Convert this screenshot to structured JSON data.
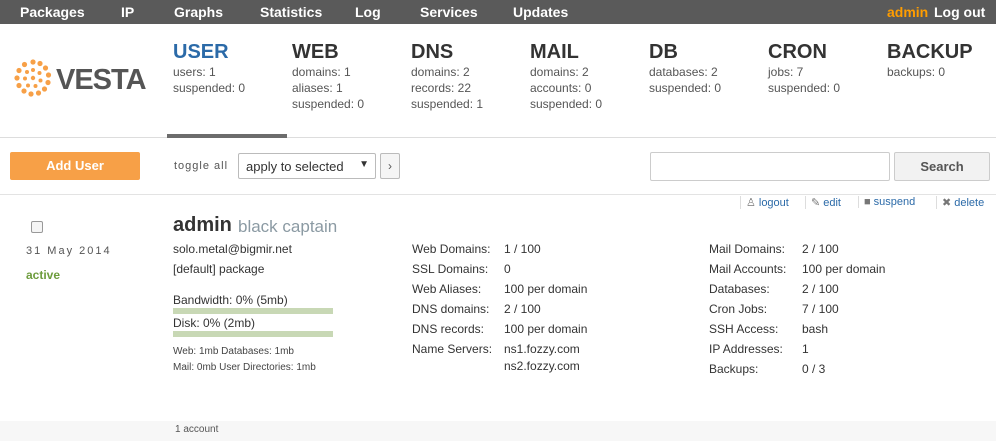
{
  "topnav": {
    "items": [
      "Packages",
      "IP",
      "Graphs",
      "Statistics",
      "Log",
      "Services",
      "Updates"
    ],
    "user": "admin",
    "logout": "Log out"
  },
  "logo": {
    "text": "VESTA",
    "color": "#f7a047"
  },
  "stats": [
    {
      "title": "USER",
      "lines": [
        "users: 1",
        "suspended: 0"
      ]
    },
    {
      "title": "WEB",
      "lines": [
        "domains: 1",
        "aliases: 1",
        "suspended: 0"
      ]
    },
    {
      "title": "DNS",
      "lines": [
        "domains: 2",
        "records: 22",
        "suspended: 1"
      ]
    },
    {
      "title": "MAIL",
      "lines": [
        "domains: 2",
        "accounts: 0",
        "suspended: 0"
      ]
    },
    {
      "title": "DB",
      "lines": [
        "databases: 2",
        "suspended: 0"
      ]
    },
    {
      "title": "CRON",
      "lines": [
        "jobs: 7",
        "suspended: 0"
      ]
    },
    {
      "title": "BACKUP",
      "lines": [
        "backups: 0"
      ]
    }
  ],
  "toolbar": {
    "add_user": "Add User",
    "toggle_all": "toggle all",
    "apply_select": "apply to selected",
    "go": "›",
    "search_button": "Search",
    "search_value": ""
  },
  "actions": {
    "logout": "logout",
    "edit": "edit",
    "suspend": "suspend",
    "delete": "delete"
  },
  "account": {
    "date": "31 May 2014",
    "status": "active",
    "username": "admin",
    "fullname": "black captain",
    "email": "solo.metal@bigmir.net",
    "package": "[default] package",
    "bandwidth_label": "Bandwidth: 0% (5mb)",
    "bandwidth_fraction": 0.0,
    "disk_label": "Disk: 0% (2mb)",
    "disk_fraction": 0.0,
    "usage_line1": "Web: 1mb Databases: 1mb",
    "usage_line2": "Mail: 0mb  User Directories: 1mb"
  },
  "details_mid": [
    {
      "k": "Web Domains:",
      "v": "1 / 100"
    },
    {
      "k": "SSL Domains:",
      "v": "0"
    },
    {
      "k": "Web Aliases:",
      "v": "100 per domain"
    },
    {
      "k": "DNS domains:",
      "v": "2 / 100"
    },
    {
      "k": "DNS records:",
      "v": "100 per domain"
    },
    {
      "k": "Name Servers:",
      "v": "ns1.fozzy.com"
    },
    {
      "k": "",
      "v": "ns2.fozzy.com"
    }
  ],
  "details_right": [
    {
      "k": "Mail Domains:",
      "v": "2 / 100"
    },
    {
      "k": "Mail Accounts:",
      "v": "100 per domain"
    },
    {
      "k": "Databases:",
      "v": "2 / 100"
    },
    {
      "k": "Cron Jobs:",
      "v": "7 / 100"
    },
    {
      "k": "SSH Access:",
      "v": "bash"
    },
    {
      "k": "IP Addresses:",
      "v": "1"
    },
    {
      "k": "Backups:",
      "v": "0 / 3"
    }
  ],
  "footer": {
    "count": "1 account"
  }
}
